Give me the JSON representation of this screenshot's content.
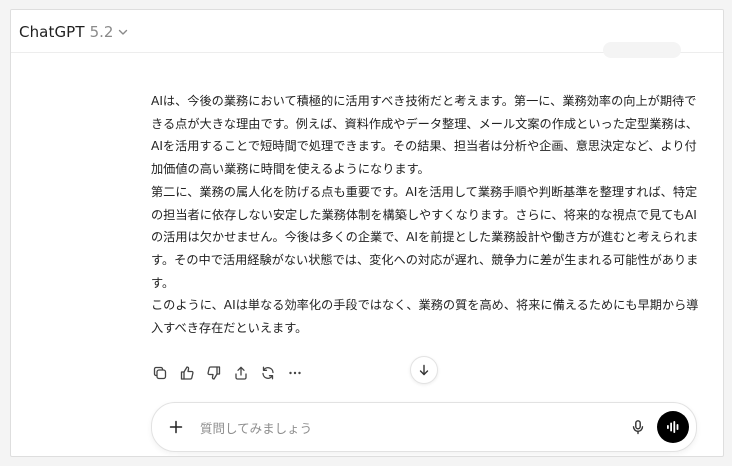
{
  "header": {
    "model_name": "ChatGPT",
    "model_version": "5.2"
  },
  "message": {
    "paragraphs": [
      "AIは、今後の業務において積極的に活用すべき技術だと考えます。第一に、業務効率の向上が期待できる点が大きな理由です。例えば、資料作成やデータ整理、メール文案の作成といった定型業務は、AIを活用することで短時間で処理できます。その結果、担当者は分析や企画、意思決定など、より付加価値の高い業務に時間を使えるようになります。",
      "第二に、業務の属人化を防げる点も重要です。AIを活用して業務手順や判断基準を整理すれば、特定の担当者に依存しない安定した業務体制を構築しやすくなります。さらに、将来的な視点で見てもAIの活用は欠かせません。今後は多くの企業で、AIを前提とした業務設計や働き方が進むと考えられます。その中で活用経験がない状態では、変化への対応が遅れ、競争力に差が生まれる可能性があります。",
      "このように、AIは単なる効率化の手段ではなく、業務の質を高め、将来に備えるためにも早期から導入すべき存在だといえます。"
    ]
  },
  "actions": {
    "icons": [
      "copy-icon",
      "thumbs-up-icon",
      "thumbs-down-icon",
      "share-icon",
      "regenerate-icon",
      "more-icon"
    ]
  },
  "composer": {
    "placeholder": "質問してみましょう"
  },
  "colors": {
    "text": "#222222",
    "muted": "#8a8a8a",
    "voice_button": "#000000"
  }
}
